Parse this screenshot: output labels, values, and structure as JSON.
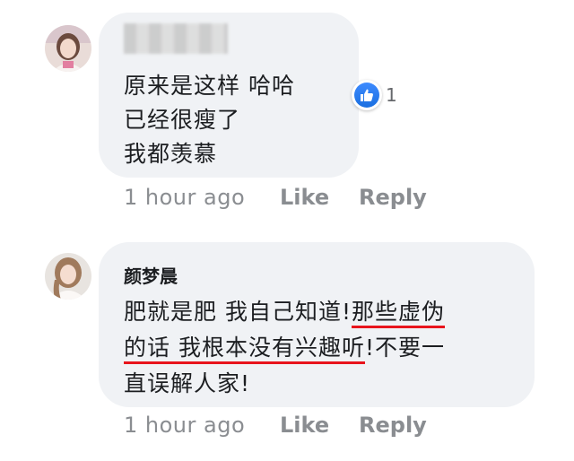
{
  "comments": [
    {
      "author": "",
      "lines": [
        "原来是这样 哈哈",
        "已经很瘦了",
        "我都羡慕"
      ],
      "reaction": {
        "icon": "like-icon",
        "count": "1",
        "color": "#1877f2"
      },
      "time": "1 hour ago",
      "like_label": "Like",
      "reply_label": "Reply"
    },
    {
      "author": "颜梦晨",
      "line1_plain": "肥就是肥 我自己知道!",
      "line1_hl": "那些虚伪",
      "line2_hl": "的话 我根本没有兴趣听",
      "line2_plain": "!不要一",
      "line3": "直误解人家!",
      "time": "1 hour ago",
      "like_label": "Like",
      "reply_label": "Reply"
    }
  ],
  "colors": {
    "bubble": "#f0f2f5",
    "text": "#1c1e21",
    "meta": "#8a8d91",
    "underline": "#e8141c"
  }
}
